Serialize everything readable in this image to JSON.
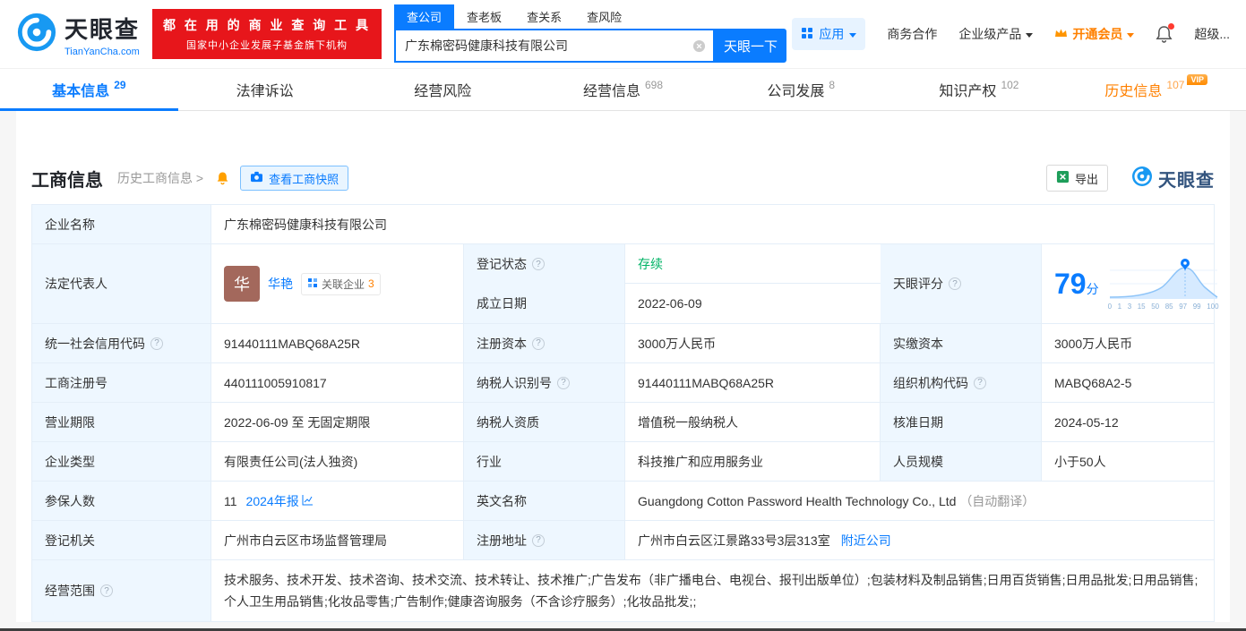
{
  "header": {
    "logo_title": "天眼查",
    "logo_subtitle": "TianYanCha.com",
    "slogan_line1": "都 在 用 的 商 业 查 询 工 具",
    "slogan_line2": "国家中小企业发展子基金旗下机构",
    "search_tabs": [
      {
        "label": "查公司"
      },
      {
        "label": "查老板"
      },
      {
        "label": "查关系"
      },
      {
        "label": "查风险"
      }
    ],
    "search_value": "广东棉密码健康科技有限公司",
    "search_button": "天眼一下",
    "nav_apps": "应用",
    "nav_cooperation": "商务合作",
    "nav_enterprise": "企业级产品",
    "nav_vip": "开通会员",
    "nav_super": "超级..."
  },
  "tabs": [
    {
      "label": "基本信息",
      "count": "29"
    },
    {
      "label": "法律诉讼",
      "count": ""
    },
    {
      "label": "经营风险",
      "count": ""
    },
    {
      "label": "经营信息",
      "count": "698"
    },
    {
      "label": "公司发展",
      "count": "8"
    },
    {
      "label": "知识产权",
      "count": "102"
    },
    {
      "label": "历史信息",
      "count": "107",
      "badge": "VIP"
    }
  ],
  "toolbar": {
    "title": "工商信息",
    "history_link": "历史工商信息 >",
    "snapshot_button": "查看工商快照",
    "export_button": "导出",
    "watermark_title": "天眼查"
  },
  "info": {
    "company_name_label": "企业名称",
    "company_name": "广东棉密码健康科技有限公司",
    "legal_rep_label": "法定代表人",
    "legal_rep_avatar": "华",
    "legal_rep_name": "华艳",
    "related_label": "关联企业",
    "related_count": "3",
    "reg_status_label": "登记状态",
    "reg_status": "存续",
    "establish_label": "成立日期",
    "establish_date": "2022-06-09",
    "score_label": "天眼评分",
    "score_value": "79",
    "score_unit": "分",
    "score_axis": [
      "0",
      "1",
      "3",
      "15",
      "50",
      "85",
      "97",
      "99",
      "100"
    ],
    "rows": [
      {
        "cells": [
          {
            "label": "统一社会信用代码",
            "value": "91440111MABQ68A25R"
          },
          {
            "label": "注册资本",
            "value": "3000万人民币"
          },
          {
            "label": "实缴资本",
            "value": "3000万人民币"
          }
        ]
      },
      {
        "cells": [
          {
            "label": "工商注册号",
            "value": "440111005910817"
          },
          {
            "label": "纳税人识别号",
            "value": "91440111MABQ68A25R"
          },
          {
            "label": "组织机构代码",
            "value": "MABQ68A2-5"
          }
        ]
      },
      {
        "cells": [
          {
            "label": "营业期限",
            "value": "2022-06-09 至 无固定期限"
          },
          {
            "label": "纳税人资质",
            "value": "增值税一般纳税人"
          },
          {
            "label": "核准日期",
            "value": "2024-05-12"
          }
        ]
      },
      {
        "cells": [
          {
            "label": "企业类型",
            "value": "有限责任公司(法人独资)"
          },
          {
            "label": "行业",
            "value": "科技推广和应用服务业"
          },
          {
            "label": "人员规模",
            "value": "小于50人"
          }
        ]
      }
    ],
    "insured_label": "参保人数",
    "insured_value": "11",
    "insured_report": "2024年报",
    "en_name_label": "英文名称",
    "en_name": "Guangdong Cotton Password Health Technology Co., Ltd",
    "en_name_note": "（自动翻译）",
    "registry_label": "登记机关",
    "registry": "广州市白云区市场监督管理局",
    "address_label": "注册地址",
    "address": "广州市白云区江景路33号3层313室",
    "address_link": "附近公司",
    "scope_label": "经营范围",
    "scope": "技术服务、技术开发、技术咨询、技术交流、技术转让、技术推广;广告发布（非广播电台、电视台、报刊出版单位）;包装材料及制品销售;日用百货销售;日用品批发;日用品销售;个人卫生用品销售;化妆品零售;广告制作;健康咨询服务（不含诊疗服务）;化妆品批发;;"
  }
}
